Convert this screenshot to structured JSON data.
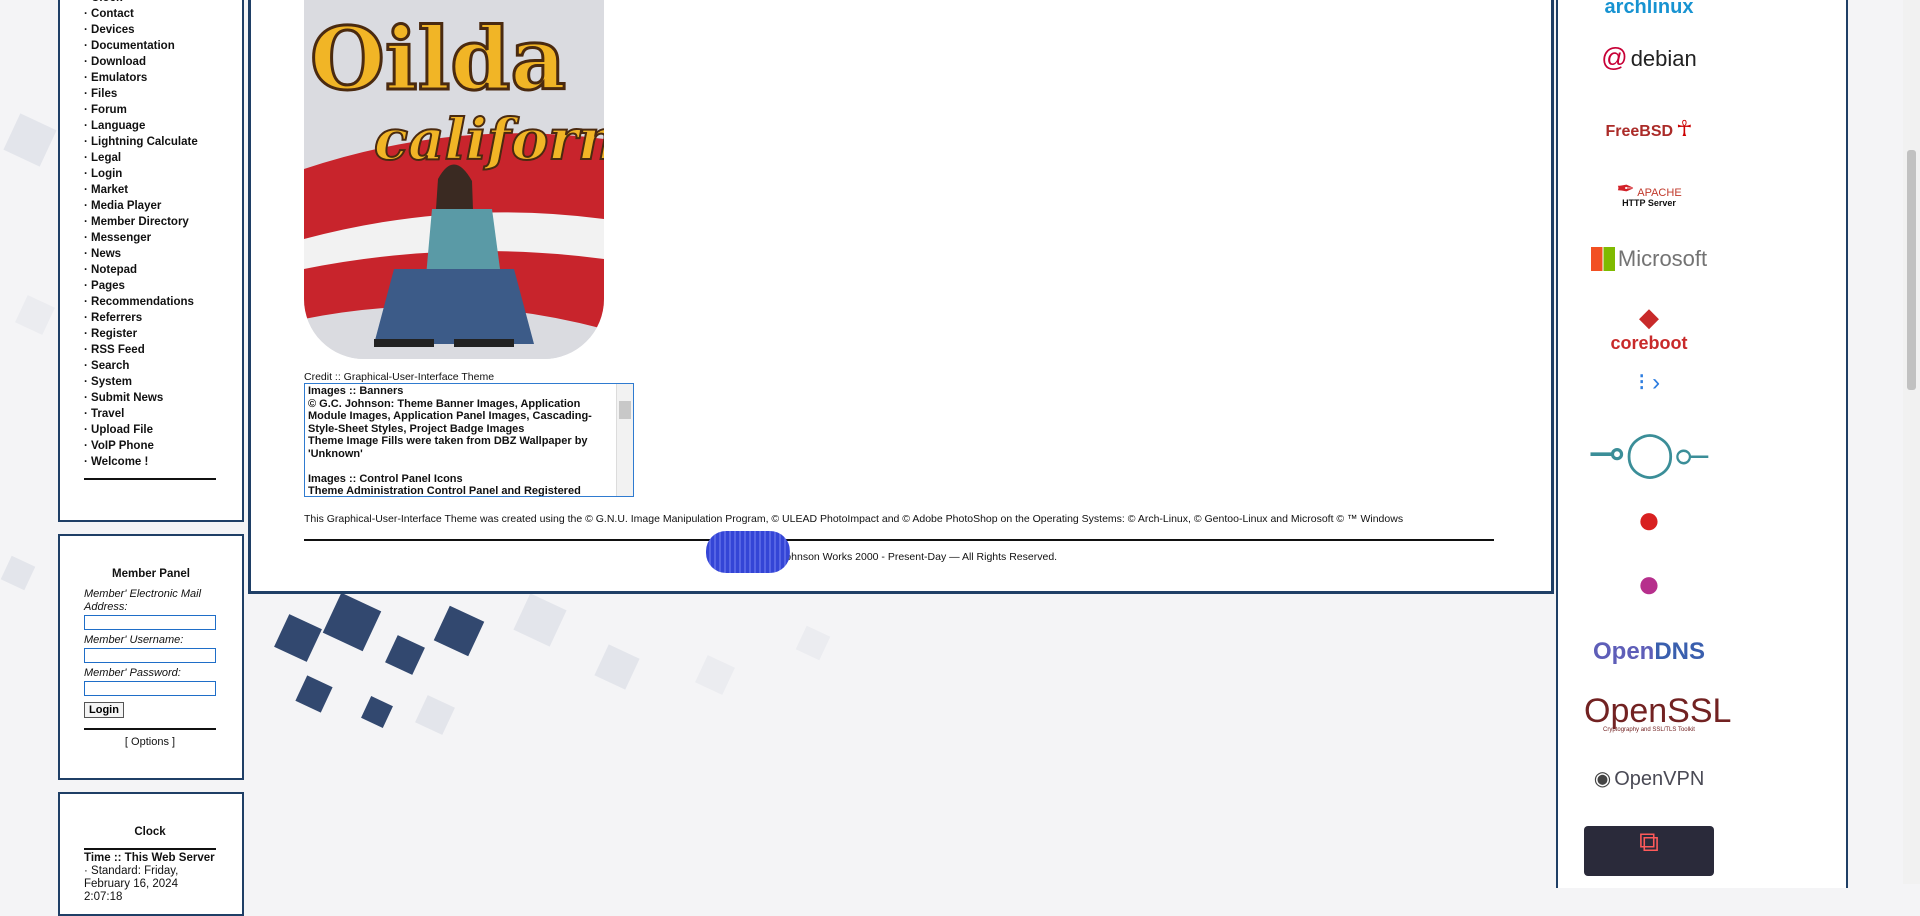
{
  "nav": {
    "items": [
      "Clock",
      "Contact",
      "Devices",
      "Documentation",
      "Download",
      "Emulators",
      "Files",
      "Forum",
      "Language",
      "Lightning Calculate",
      "Legal",
      "Login",
      "Market",
      "Media Player",
      "Member Directory",
      "Messenger",
      "News",
      "Notepad",
      "Pages",
      "Recommendations",
      "Referrers",
      "Register",
      "RSS Feed",
      "Search",
      "System",
      "Submit News",
      "Travel",
      "Upload File",
      "VoIP Phone",
      "Welcome !"
    ]
  },
  "member_panel": {
    "title": "Member Panel",
    "email_label": "Member' Electronic Mail Address:",
    "username_label": "Member' Username:",
    "password_label": "Member' Password:",
    "login_button": "Login",
    "options_link": "[ Options ]"
  },
  "clock_panel": {
    "title": "Clock",
    "subtitle": "Time :: This Web Server",
    "line": "· Standard: Friday, February 16, 2024 2:07:18"
  },
  "main": {
    "photo_text": "Oildale california",
    "credit_label": "Credit :: Graphical-User-Interface Theme",
    "credit_text": "Images :: Banners\n© G.C. Johnson: Theme Banner Images, Application Module Images, Application Panel Images, Cascading-Style-Sheet Styles, Project Badge Images\nTheme Image Fills were taken from DBZ Wallpaper by 'Unknown'\n\nImages :: Control Panel Icons\nTheme Administration Control Panel and Registered",
    "footer_note": "This Graphical-User-Interface Theme was created using the © G.N.U. Image Manipulation Program, © ULEAD PhotoImpact and © Adobe PhotoShop on the Operating Systems: © Arch-Linux, © Gentoo-Linux and Microsoft © ™ Windows",
    "copyright": "© G.C. Johnson Works 2000 - Present-Day — All Rights Reserved."
  },
  "logos": {
    "arch": "archlinux",
    "debian": "debian",
    "freebsd": "FreeBSD",
    "apache_top": "APACHE",
    "apache_bottom": "HTTP Server",
    "microsoft": "Microsoft",
    "coreboot": "coreboot",
    "opendns_a": "Open",
    "opendns_b": "DNS",
    "openssl": "OpenSSL",
    "openssl_sub": "Cryptography and SSL/TLS Toolkit",
    "openvpn": "OpenVPN"
  }
}
